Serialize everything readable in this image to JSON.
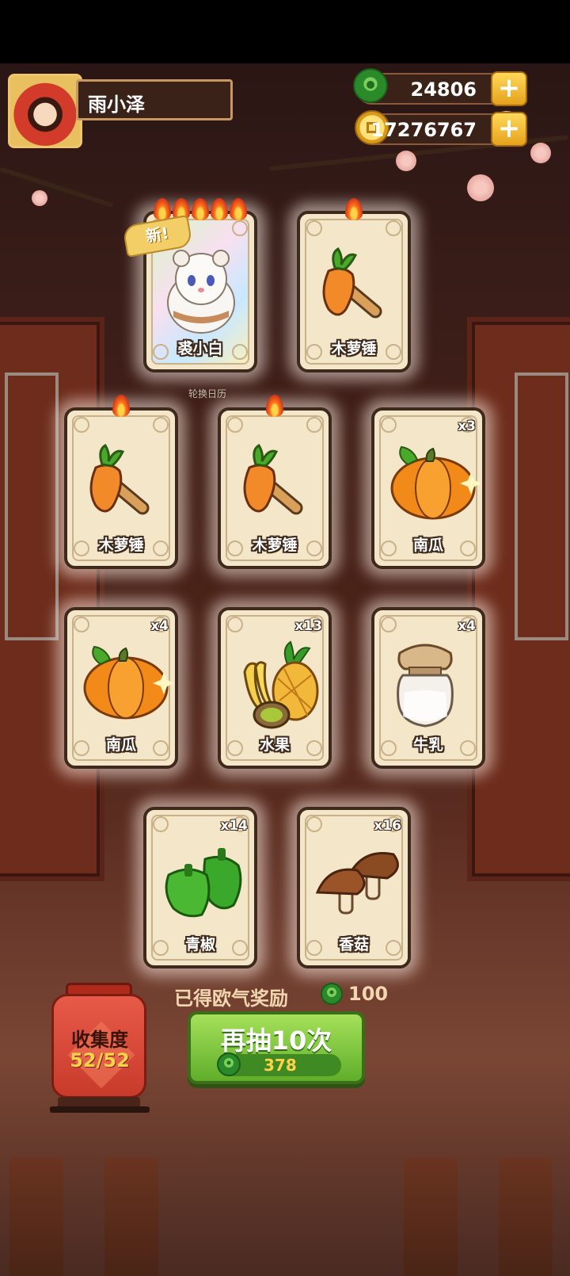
{
  "player": {
    "name": "雨小泽"
  },
  "currency": {
    "jade": {
      "icon": "jade-coin-icon",
      "value": "24806"
    },
    "gold": {
      "icon": "gold-coin-icon",
      "value": "17276767"
    }
  },
  "new_badge": "新!",
  "background_caption": "轮换日历",
  "cards": [
    {
      "id": "card-1",
      "label": "裘小白",
      "count": "",
      "flames": 5,
      "new": true,
      "art": "white-cat-art"
    },
    {
      "id": "card-2",
      "label": "木萝锤",
      "count": "",
      "flames": 1,
      "new": false,
      "art": "carrot-hammer-art"
    },
    {
      "id": "card-3",
      "label": "木萝锤",
      "count": "",
      "flames": 1,
      "new": false,
      "art": "carrot-hammer-art"
    },
    {
      "id": "card-4",
      "label": "木萝锤",
      "count": "",
      "flames": 1,
      "new": false,
      "art": "carrot-hammer-art"
    },
    {
      "id": "card-5",
      "label": "南瓜",
      "count": "x3",
      "flames": 0,
      "new": false,
      "art": "pumpkin-art"
    },
    {
      "id": "card-6",
      "label": "南瓜",
      "count": "x4",
      "flames": 0,
      "new": false,
      "art": "pumpkin-art"
    },
    {
      "id": "card-7",
      "label": "水果",
      "count": "x13",
      "flames": 0,
      "new": false,
      "art": "fruit-art"
    },
    {
      "id": "card-8",
      "label": "牛乳",
      "count": "x4",
      "flames": 0,
      "new": false,
      "art": "milk-jar-art"
    },
    {
      "id": "card-9",
      "label": "青椒",
      "count": "x14",
      "flames": 0,
      "new": false,
      "art": "green-pepper-art"
    },
    {
      "id": "card-10",
      "label": "香菇",
      "count": "x16",
      "flames": 0,
      "new": false,
      "art": "mushroom-art"
    }
  ],
  "reward": {
    "label": "已得欧气奖励",
    "value": "100"
  },
  "draw_button": {
    "label": "再抽10次",
    "cost": "378"
  },
  "collection": {
    "title": "收集度",
    "progress": "52/52"
  },
  "colors": {
    "accent_green": "#5fae2a",
    "gold": "#f3cd66",
    "card_bg": "#f4e6c8"
  }
}
